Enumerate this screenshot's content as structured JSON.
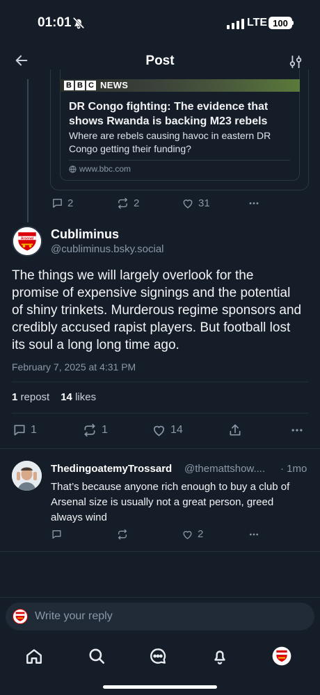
{
  "status_bar": {
    "time": "01:01",
    "network": "LTE",
    "battery": "100"
  },
  "header": {
    "title": "Post"
  },
  "quote_card": {
    "source_logo": [
      "B",
      "B",
      "C"
    ],
    "source_label": "NEWS",
    "title": "DR Congo fighting: The evidence that shows Rwanda is backing M23 rebels",
    "description": "Where are rebels causing havoc in eastern DR Congo getting their funding?",
    "domain": "www.bbc.com"
  },
  "parent_actions": {
    "replies": "2",
    "reposts": "2",
    "likes": "31"
  },
  "post": {
    "author_name": "Cubliminus",
    "author_handle": "@cubliminus.bsky.social",
    "avatar_label": "Arsenal",
    "text": "The things we will largely overlook for the promise of expensive signings and the potential of shiny trinkets. Murderous regime sponsors and credibly accused rapist players. But football lost its soul a long long time ago.",
    "date": "February 7, 2025 at 4:31 PM",
    "repost_count": "1",
    "repost_label": "repost",
    "like_count": "14",
    "like_label": "likes",
    "actions": {
      "replies": "1",
      "reposts": "1",
      "likes": "14"
    }
  },
  "reply": {
    "author_name": "ThedingoatemyTrossard",
    "author_handle": "@themattshow....",
    "time": "· 1mo",
    "text": "That’s because anyone rich enough to buy a club of Arsenal size is usually not a great person, greed always wind",
    "actions": {
      "likes": "2"
    }
  },
  "composer": {
    "placeholder": "Write your reply"
  },
  "colors": {
    "background": "#151d28",
    "muted": "#8a98a8",
    "divider": "#26303d",
    "arsenal_red": "#db0007"
  }
}
